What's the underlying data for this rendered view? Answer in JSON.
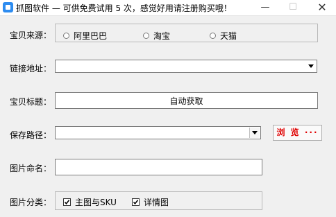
{
  "window": {
    "title": "抓图软件 — 可供免费试用 5 次，感觉好用请注册购买哦！",
    "minimize": "—",
    "maximize": "☐",
    "close": "✕"
  },
  "source": {
    "label": "宝贝来源：",
    "options": [
      "阿里巴巴",
      "淘宝",
      "天猫"
    ]
  },
  "link": {
    "label": "链接地址：",
    "value": ""
  },
  "title_field": {
    "label": "宝贝标题：",
    "value": "自动获取"
  },
  "save_path": {
    "label": "保存路径：",
    "value": "",
    "browse_label": "浏 览 ···"
  },
  "image_name": {
    "label": "图片命名：",
    "value": ""
  },
  "category": {
    "label": "图片分类：",
    "options": [
      {
        "label": "主图与SKU",
        "checked": true
      },
      {
        "label": "详情图",
        "checked": true
      }
    ]
  }
}
